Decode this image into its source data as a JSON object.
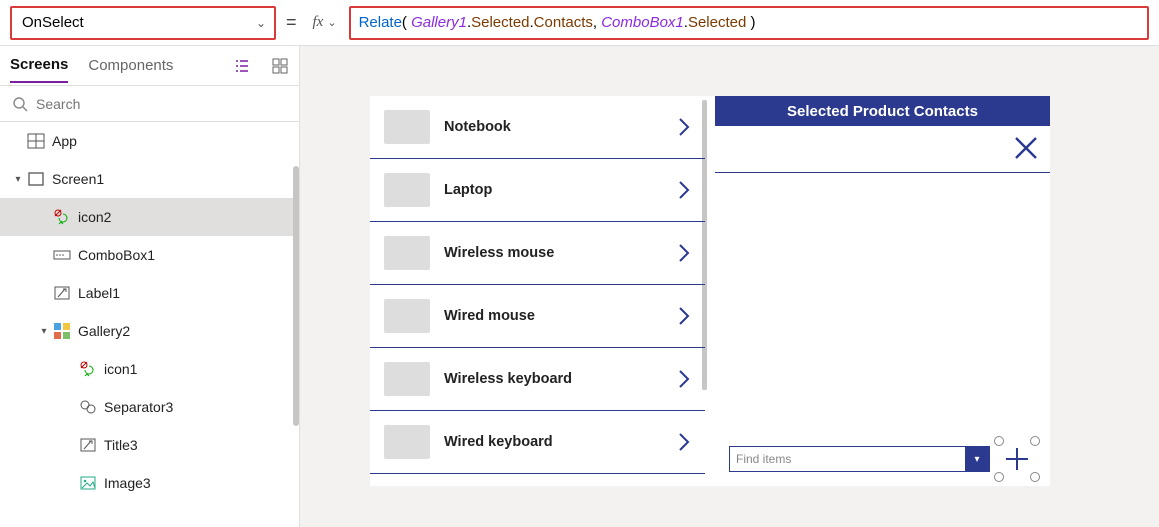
{
  "formula_bar": {
    "property": "OnSelect",
    "equals": "=",
    "fx_label": "fx",
    "formula_tokens": [
      {
        "t": "fn",
        "v": "Relate"
      },
      {
        "t": "plain",
        "v": "( "
      },
      {
        "t": "var",
        "v": "Gallery1"
      },
      {
        "t": "plain",
        "v": "."
      },
      {
        "t": "prop",
        "v": "Selected"
      },
      {
        "t": "plain",
        "v": "."
      },
      {
        "t": "prop",
        "v": "Contacts"
      },
      {
        "t": "plain",
        "v": ", "
      },
      {
        "t": "var",
        "v": "ComboBox1"
      },
      {
        "t": "plain",
        "v": "."
      },
      {
        "t": "prop",
        "v": "Selected"
      },
      {
        "t": "plain",
        "v": " )"
      }
    ]
  },
  "left_panel": {
    "tabs": {
      "screens": "Screens",
      "components": "Components"
    },
    "search_placeholder": "Search",
    "tree": [
      {
        "depth": 0,
        "caret": "",
        "icon": "app",
        "label": "App"
      },
      {
        "depth": 0,
        "caret": "▾",
        "icon": "screen",
        "label": "Screen1"
      },
      {
        "depth": 1,
        "caret": "",
        "icon": "iconctl",
        "label": "icon2",
        "selected": true
      },
      {
        "depth": 1,
        "caret": "",
        "icon": "combobox",
        "label": "ComboBox1"
      },
      {
        "depth": 1,
        "caret": "",
        "icon": "label",
        "label": "Label1"
      },
      {
        "depth": 1,
        "caret": "▾",
        "icon": "gallery",
        "label": "Gallery2"
      },
      {
        "depth": 2,
        "caret": "",
        "icon": "iconctl",
        "label": "icon1"
      },
      {
        "depth": 2,
        "caret": "",
        "icon": "separator",
        "label": "Separator3"
      },
      {
        "depth": 2,
        "caret": "",
        "icon": "label",
        "label": "Title3"
      },
      {
        "depth": 2,
        "caret": "",
        "icon": "image",
        "label": "Image3"
      }
    ]
  },
  "canvas": {
    "gallery_items": [
      "Notebook",
      "Laptop",
      "Wireless mouse",
      "Wired mouse",
      "Wireless keyboard",
      "Wired keyboard"
    ],
    "detail": {
      "header": "Selected Product Contacts",
      "combo_placeholder": "Find items"
    }
  }
}
